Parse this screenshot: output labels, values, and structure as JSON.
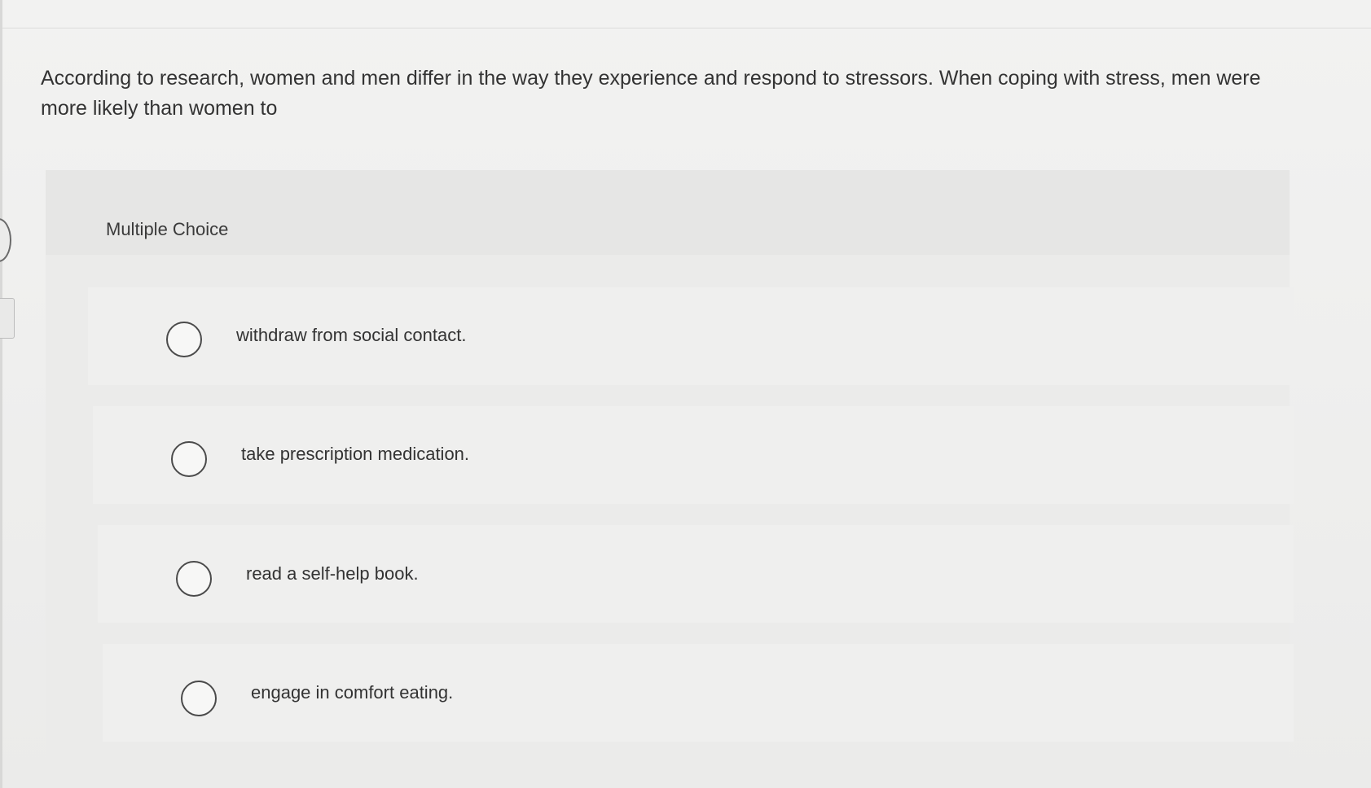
{
  "question": {
    "text": "According to research, women and men differ in the way they experience and respond to stressors. When coping with stress, men were more likely than women to"
  },
  "multiple_choice": {
    "label": "Multiple Choice",
    "options": [
      {
        "text": "withdraw from social contact."
      },
      {
        "text": "take prescription medication."
      },
      {
        "text": "read a self-help book."
      },
      {
        "text": "engage in comfort eating."
      }
    ]
  },
  "colors": {
    "background": "#f0f0ef",
    "panel": "#e9e9e8",
    "text": "#333333",
    "radio_border": "#4a4a4a"
  }
}
